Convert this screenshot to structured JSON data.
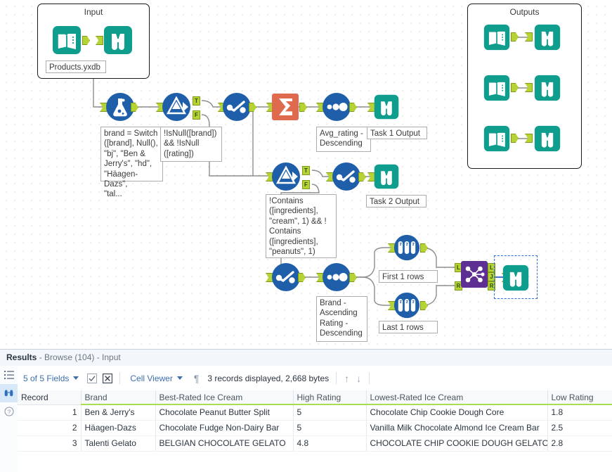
{
  "canvas": {
    "containers": [
      {
        "name": "input-container",
        "title": "Input"
      },
      {
        "name": "outputs-container",
        "title": "Outputs"
      }
    ],
    "annotations": {
      "input_file": "Products.yxdb",
      "formula": "brand = Switch\n([brand], Null(),\n\"bj\", \"Ben &\nJerry's\", \"hd\",\n\"Häagen-Dazs\",\n\"tal...",
      "filter1": "!IsNull([brand])\n&& !IsNull\n([rating])",
      "sort1": "Avg_rating -\nDescending",
      "task1_output": "Task 1 Output",
      "filter2": "!Contains\n([ingredients],\n\"cream\", 1) && !\nContains\n([ingredients],\n\"peanuts\", 1)",
      "task2_output": "Task 2 Output",
      "sort2": "Brand -\nAscending\nRating -\nDescending",
      "sample_first": "First 1 rows",
      "sample_last": "Last 1 rows"
    },
    "anchor_labels": {
      "true": "T",
      "false": "F",
      "left": "L",
      "join": "J",
      "right": "R"
    },
    "icon_names": {
      "input": "input-data-icon",
      "browse": "browse-binoculars-icon",
      "formula": "formula-flask-icon",
      "filter": "filter-funnel-icon",
      "select": "select-checkmark-icon",
      "summarize": "summarize-sigma-icon",
      "sort": "sort-dots-icon",
      "sample": "sample-testtubes-icon",
      "join": "join-nodes-icon"
    },
    "colors": {
      "teal": "#0f9e8e",
      "blue": "#1f5faa",
      "sigma": "#e06a4d",
      "purple": "#5e2f92",
      "anchor": "#b5d334",
      "wire": "#8d8d8d",
      "selection": "#2f6fd8"
    }
  },
  "results": {
    "title_label": "Results",
    "title_suffix": " - Browse (104) - Input",
    "rail": [
      {
        "name": "fields-list-icon",
        "label": "list"
      },
      {
        "name": "browse-binoculars-icon",
        "label": "browse"
      },
      {
        "name": "help-question-icon",
        "label": "help"
      }
    ],
    "toolbar": {
      "fields_label": "5 of 5 Fields",
      "check_all_icon": "check-box-icon",
      "uncheck_all_icon": "clear-box-icon",
      "viewer_label": "Cell Viewer",
      "pilcrow_icon": "pilcrow-icon",
      "records_text": "3 records displayed, 2,668 bytes",
      "up_icon": "arrow-up-icon",
      "down_icon": "arrow-down-icon"
    },
    "table": {
      "columns": [
        "Record",
        "Brand",
        "Best-Rated Ice Cream",
        "High Rating",
        "Lowest-Rated Ice Cream",
        "Low Rating"
      ],
      "rows": [
        {
          "record": "1",
          "brand": "Ben & Jerry's",
          "best": "Chocolate Peanut Butter Split",
          "high": "5",
          "lowest": "Chocolate Chip Cookie Dough Core",
          "low": "1.8"
        },
        {
          "record": "2",
          "brand": "Häagen-Dazs",
          "best": "Chocolate Fudge Non-Dairy Bar",
          "high": "5",
          "lowest": "Vanilla Milk Chocolate Almond Ice Cream Bar",
          "low": "2.5"
        },
        {
          "record": "3",
          "brand": "Talenti Gelato",
          "best": "BELGIAN CHOCOLATE GELATO",
          "high": "4.8",
          "lowest": "CHOCOLATE CHIP COOKIE DOUGH GELATO",
          "low": "2.8"
        }
      ]
    }
  }
}
